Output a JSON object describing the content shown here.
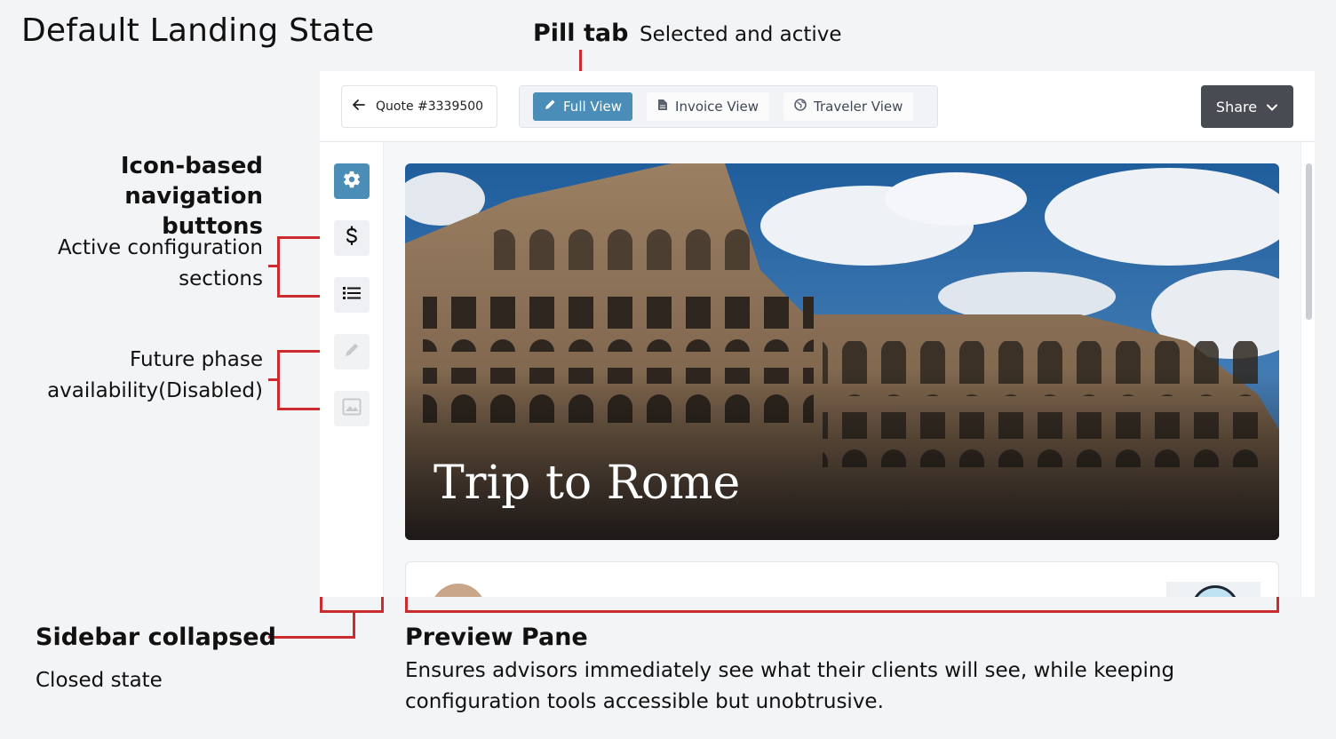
{
  "page_title": "Default Landing State",
  "annotations": {
    "pill_tab_title": "Pill tab",
    "pill_tab_desc": "Selected and active",
    "icon_nav_line1": "Icon-based",
    "icon_nav_line2": "navigation buttons",
    "active_config_line1": "Active configuration",
    "active_config_line2": "sections",
    "future_line1": "Future phase",
    "future_line2": "availability(Disabled)",
    "sidebar_title": "Sidebar collapsed",
    "sidebar_desc": "Closed state",
    "preview_title": "Preview Pane",
    "preview_line1": "Ensures advisors immediately see what their clients will see, while keeping",
    "preview_line2": "configuration tools accessible but unobtrusive."
  },
  "topbar": {
    "quote_label": "Quote #3339500",
    "tabs": [
      {
        "label": "Full View",
        "icon": "pencil-icon",
        "active": true
      },
      {
        "label": "Invoice View",
        "icon": "document-icon",
        "active": false
      },
      {
        "label": "Traveler View",
        "icon": "globe-icon",
        "active": false
      }
    ],
    "share_label": "Share"
  },
  "sidebar": {
    "items": [
      {
        "icon": "gear-icon",
        "state": "active"
      },
      {
        "icon": "dollar-icon",
        "state": "enabled"
      },
      {
        "icon": "list-icon",
        "state": "enabled"
      },
      {
        "icon": "pencil-icon",
        "state": "disabled"
      },
      {
        "icon": "image-icon",
        "state": "disabled"
      }
    ]
  },
  "preview": {
    "hero_title": "Trip to Rome"
  },
  "colors": {
    "accent": "#4a8db7",
    "annotation_red": "#cc2b2f",
    "share_bg": "#484c52"
  }
}
